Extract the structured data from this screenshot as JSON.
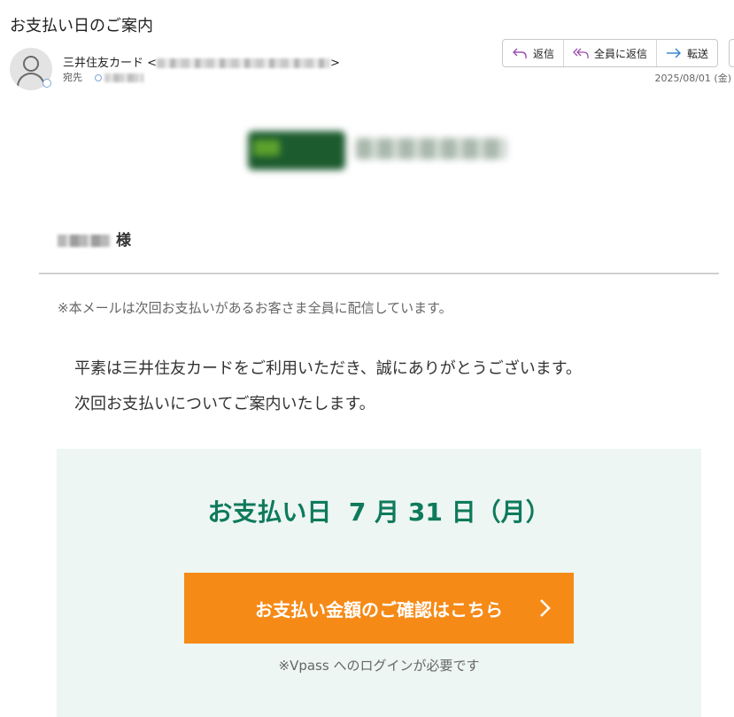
{
  "email": {
    "subject": "お支払い日のご案内",
    "sender_name": "三井住友カード <",
    "sender_close": ">",
    "to_label": "宛先",
    "date": "2025/08/01 (金)"
  },
  "actions": {
    "reply": "返信",
    "reply_all": "全員に返信",
    "forward": "転送"
  },
  "body": {
    "salutation_suffix": "様",
    "notice": "※本メールは次回お支払いがあるお客さま全員に配信しています。",
    "para1": "平素は三井住友カードをご利用いただき、誠にありがとうございます。",
    "para2": "次回お支払いについてご案内いたします。",
    "payday": "お支払い日  7 月 31 日（月）",
    "cta_label": "お支払い金額のご確認はこちら",
    "login_note": "※Vpass へのログインが必要です"
  },
  "colors": {
    "accent_green": "#0e7a5c",
    "cta_orange": "#f68a17",
    "panel_bg": "#edf6f2",
    "reply_icon": "#9b4fb0",
    "forward_icon": "#2f7fd0"
  },
  "icons": {
    "reply": "reply-icon",
    "reply_all": "reply-all-icon",
    "forward": "forward-arrow-icon",
    "cta": "chevron-right-icon",
    "avatar": "person-icon"
  }
}
